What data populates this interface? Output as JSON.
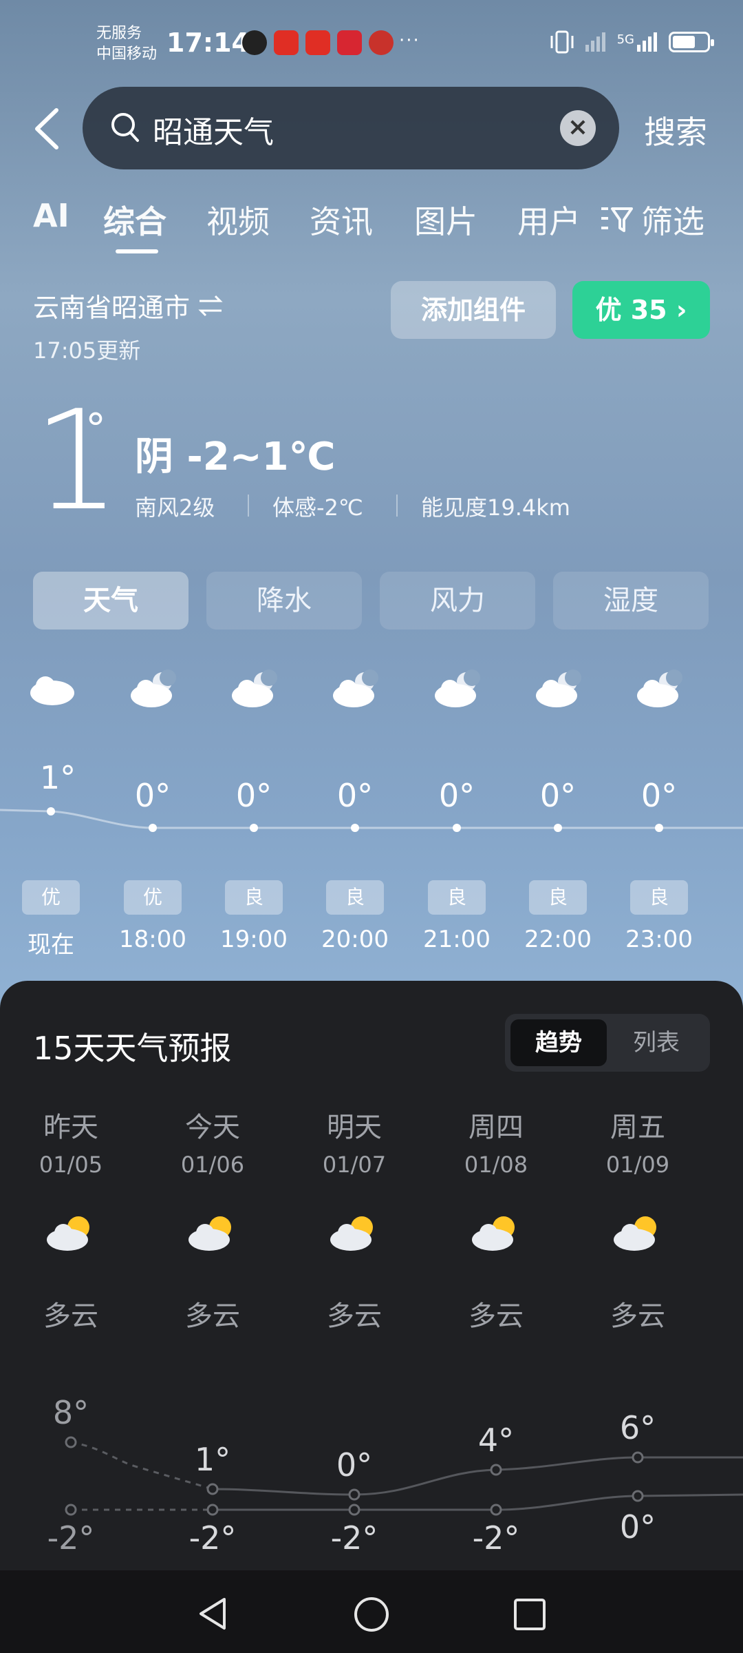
{
  "status_bar": {
    "carrier_line1": "无服务",
    "carrier_line2": "中国移动",
    "time": "17:14",
    "more": "···",
    "network": "5G"
  },
  "search": {
    "query": "昭通天气",
    "search_label": "搜索"
  },
  "tabs": [
    "AI",
    "综合",
    "视频",
    "资讯",
    "图片",
    "用户",
    "筛选"
  ],
  "location": {
    "city": "云南省昭通市",
    "updated": "17:05更新",
    "add_widget": "添加组件",
    "aqi": "优 35"
  },
  "current": {
    "temp": "1",
    "deg": "°",
    "condition": "阴  -2~1℃",
    "wind": "南风2级",
    "feels": "体感-2℃",
    "visibility": "能见度19.4km"
  },
  "segments": [
    "天气",
    "降水",
    "风力",
    "湿度"
  ],
  "hourly": [
    {
      "temp": "1°",
      "aqi": "优",
      "time": "现在"
    },
    {
      "temp": "0°",
      "aqi": "优",
      "time": "18:00"
    },
    {
      "temp": "0°",
      "aqi": "良",
      "time": "19:00"
    },
    {
      "temp": "0°",
      "aqi": "良",
      "time": "20:00"
    },
    {
      "temp": "0°",
      "aqi": "良",
      "time": "21:00"
    },
    {
      "temp": "0°",
      "aqi": "良",
      "time": "22:00"
    },
    {
      "temp": "0°",
      "aqi": "良",
      "time": "23:00"
    }
  ],
  "forecast": {
    "title": "15天天气预报",
    "toggle_on": "趋势",
    "toggle_off": "列表",
    "days": [
      {
        "name": "昨天",
        "date": "01/05",
        "cond": "多云",
        "hi": "8°",
        "lo": "-2°"
      },
      {
        "name": "今天",
        "date": "01/06",
        "cond": "多云",
        "hi": "1°",
        "lo": "-2°"
      },
      {
        "name": "明天",
        "date": "01/07",
        "cond": "多云",
        "hi": "0°",
        "lo": "-2°"
      },
      {
        "name": "周四",
        "date": "01/08",
        "cond": "多云",
        "hi": "4°",
        "lo": "-2°"
      },
      {
        "name": "周五",
        "date": "01/09",
        "cond": "多云",
        "hi": "6°",
        "lo": "0°"
      }
    ]
  },
  "colors": {
    "aqi_green": "#2dd196",
    "panel_bg": "#1f2023"
  }
}
